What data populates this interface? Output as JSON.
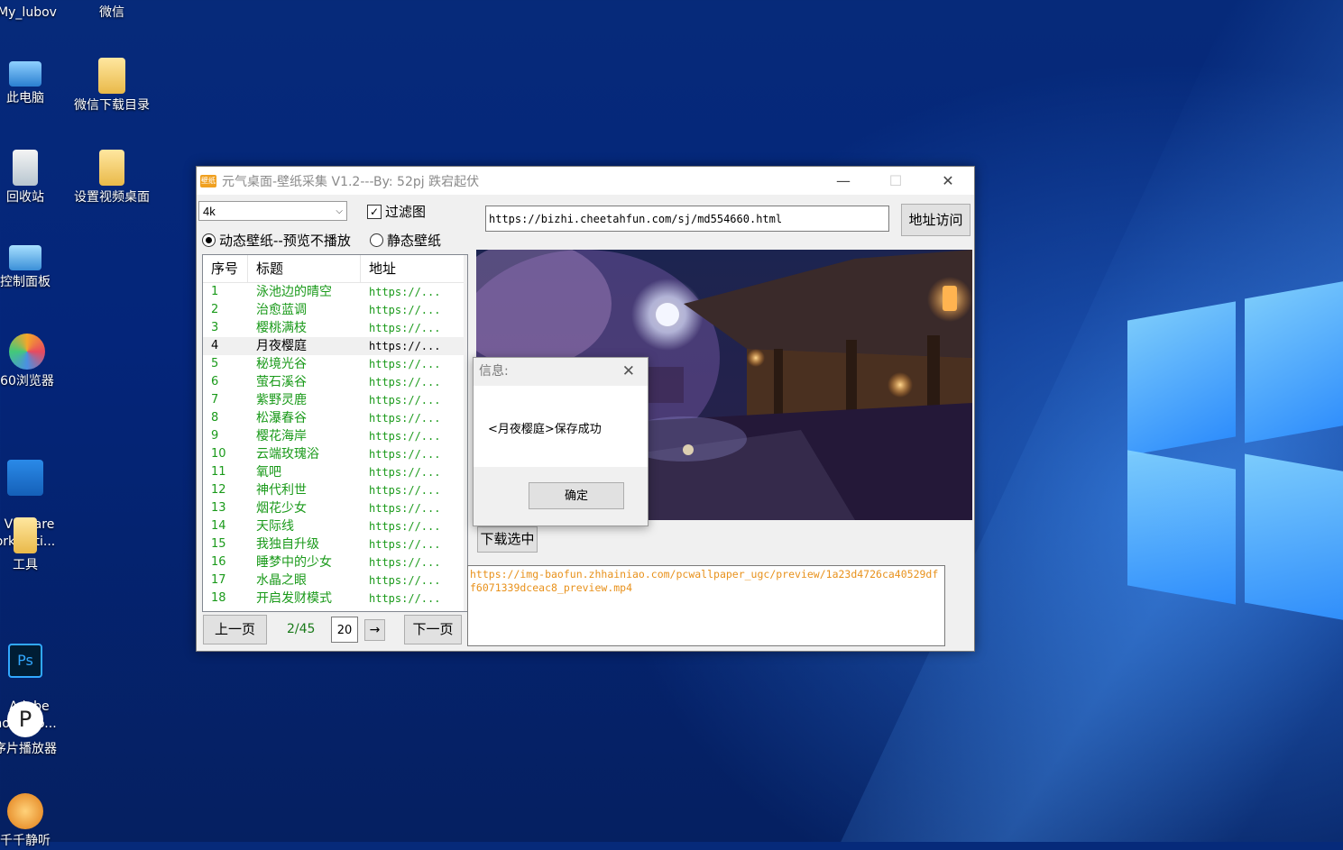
{
  "desktop": {
    "icons": [
      {
        "label": "My_lubov"
      },
      {
        "label": "微信"
      },
      {
        "label": "此电脑"
      },
      {
        "label": "微信下载目录"
      },
      {
        "label": "回收站"
      },
      {
        "label": "设置视频桌面"
      },
      {
        "label": "控制面板"
      },
      {
        "label": "60浏览器"
      },
      {
        "label": "VMware\norkstati..."
      },
      {
        "label": "工具"
      },
      {
        "label": "Adobe\nhotosho..."
      },
      {
        "label": "序片播放器"
      },
      {
        "label": "千千静听"
      }
    ]
  },
  "app": {
    "icon_text": "壁纸",
    "title": "元气桌面-壁纸采集 V1.2---By: 52pj 跌宕起伏",
    "minimize": "—",
    "maximize": "☐",
    "close": "✕",
    "resolution": "4k",
    "filter_label": "过滤图",
    "filter_checked": true,
    "radio_dynamic": "动态壁纸--预览不播放",
    "radio_static": "静态壁纸",
    "url": "https://bizhi.cheetahfun.com/sj/md554660.html",
    "visit_btn": "地址访问",
    "columns": [
      "序号",
      "标题",
      "地址"
    ],
    "rows": [
      {
        "no": "1",
        "title": "泳池边的晴空",
        "url": "https://..."
      },
      {
        "no": "2",
        "title": "治愈蓝调",
        "url": "https://..."
      },
      {
        "no": "3",
        "title": "樱桃满枝",
        "url": "https://..."
      },
      {
        "no": "4",
        "title": "月夜樱庭",
        "url": "https://..."
      },
      {
        "no": "5",
        "title": "秘境光谷",
        "url": "https://..."
      },
      {
        "no": "6",
        "title": "萤石溪谷",
        "url": "https://..."
      },
      {
        "no": "7",
        "title": "紫野灵鹿",
        "url": "https://..."
      },
      {
        "no": "8",
        "title": "松瀑春谷",
        "url": "https://..."
      },
      {
        "no": "9",
        "title": "樱花海岸",
        "url": "https://..."
      },
      {
        "no": "10",
        "title": "云端玫瑰浴",
        "url": "https://..."
      },
      {
        "no": "11",
        "title": "氧吧",
        "url": "https://..."
      },
      {
        "no": "12",
        "title": "神代利世",
        "url": "https://..."
      },
      {
        "no": "13",
        "title": "烟花少女",
        "url": "https://..."
      },
      {
        "no": "14",
        "title": "天际线",
        "url": "https://..."
      },
      {
        "no": "15",
        "title": "我独自升级",
        "url": "https://..."
      },
      {
        "no": "16",
        "title": "睡梦中的少女",
        "url": "https://..."
      },
      {
        "no": "17",
        "title": "水晶之眼",
        "url": "https://..."
      },
      {
        "no": "18",
        "title": "开启发财模式",
        "url": "https://..."
      }
    ],
    "selected_row": 4,
    "prev_btn": "上一页",
    "page": "2/45",
    "page_size": "20",
    "go_arrow": "→",
    "next_btn": "下一页",
    "download_btn": "下载选中",
    "log": "https://img-baofun.zhhainiao.com/pcwallpaper_ugc/preview/1a23d4726ca40529dff6071339dceac8_preview.mp4"
  },
  "dialog": {
    "title": "信息:",
    "close": "✕",
    "message": "<月夜樱庭>保存成功",
    "ok": "确定"
  }
}
